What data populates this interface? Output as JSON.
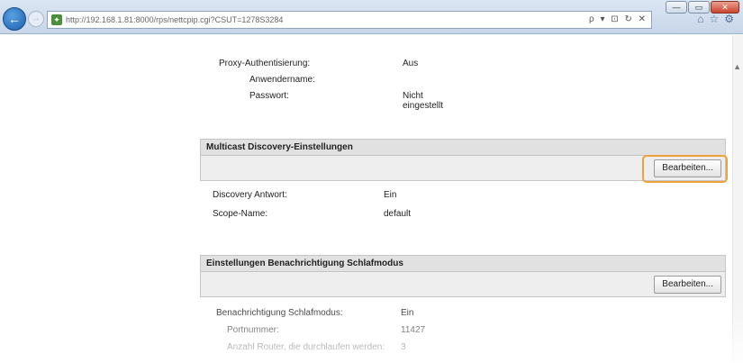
{
  "browser": {
    "url": "http://192.168.1.81:8000/rps/nettcpip.cgi?CSUT=1278S3284",
    "tools": "ρ ▾ ⊡ ↻ ✕",
    "window_buttons": {
      "minimize": "—",
      "maximize": "▭",
      "close": "✕"
    }
  },
  "proxy": {
    "auth_label": "Proxy-Authentisierung:",
    "auth_value": "Aus",
    "username_label": "Anwendername:",
    "password_label": "Passwort:",
    "password_value": "Nicht eingestellt"
  },
  "multicast": {
    "title": "Multicast Discovery-Einstellungen",
    "edit_label": "Bearbeiten...",
    "response_label": "Discovery Antwort:",
    "response_value": "Ein",
    "scope_label": "Scope-Name:",
    "scope_value": "default"
  },
  "sleep": {
    "title": "Einstellungen Benachrichtigung Schlafmodus",
    "edit_label": "Bearbeiten...",
    "notify_label": "Benachrichtigung Schlafmodus:",
    "notify_value": "Ein",
    "port_label": "Portnummer:",
    "port_value": "11427",
    "routers_label": "Anzahl Router, die durchlaufen werden:",
    "routers_value": "3"
  },
  "colors": {
    "highlight": "#f0a23a",
    "section_header": "#e1e1e1"
  }
}
